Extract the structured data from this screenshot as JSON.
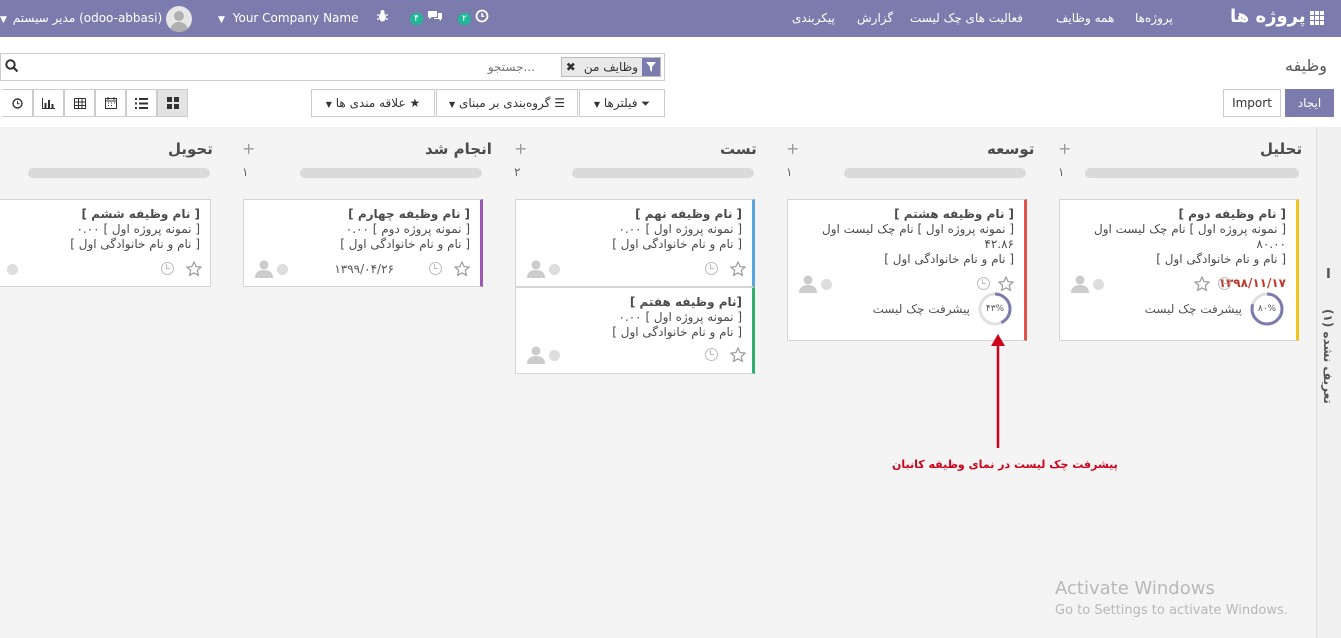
{
  "topbar": {
    "app_title": "پروژه ها",
    "menu": [
      "پروژه‌ها",
      "همه وظایف",
      "فعالیت های چک لیست",
      "گزارش",
      "پیکربندی"
    ],
    "activity_badge": "۲",
    "messages_badge": "۴",
    "company": "Your Company Name",
    "user": "مدیر سیستم (odoo-abbasi)"
  },
  "control": {
    "breadcrumb": "وظیفه",
    "facet_label": "وظایف من",
    "search_placeholder": "جستجو...",
    "create_label": "ایجاد",
    "import_label": "Import",
    "filters_label": "فیلترها",
    "groupby_label": "گروه‌بندی بر مبنای",
    "favorites_label": "علاقه مندی ها"
  },
  "columns": [
    {
      "title": "تحلیل",
      "count": "۱"
    },
    {
      "title": "توسعه",
      "count": "۱"
    },
    {
      "title": "تست",
      "count": "۲"
    },
    {
      "title": "انجام شد",
      "count": "۱"
    },
    {
      "title": "تحویل",
      "count": ""
    }
  ],
  "cards": {
    "c1": {
      "title": "[ نام وظیفه دوم ]",
      "project": "[ نمونه پروژه اول ] نام چک لیست اول",
      "value": "۸۰.۰۰",
      "user": "[ نام و نام خانوادگی اول ]",
      "deadline": "۱۳۹۸/۱۱/۱۷",
      "progress_text": "۸۰%",
      "progress_value": 0.8,
      "progress_label": "پیشرفت چک لیست",
      "accent": "#f0c419"
    },
    "c2": {
      "title": "[ نام وظیفه هشتم ]",
      "project": "[ نمونه پروژه اول ] نام چک لیست اول",
      "value": "۴۲.۸۶",
      "user": "[ نام و نام خانوادگی اول ]",
      "progress_text": "۴۳%",
      "progress_value": 0.43,
      "progress_label": "پیشرفت چک لیست",
      "accent": "#e4544a"
    },
    "c3": {
      "title": "[ نام وظیفه نهم ]",
      "project": "[ نمونه پروژه اول ] ۰.۰۰",
      "user": "[ نام و نام خانوادگی اول ]",
      "accent": "#5aa6e0"
    },
    "c4": {
      "title": "[نام وظیفه هفتم ]",
      "project": "[ نمونه پروژه اول ] ۰.۰۰",
      "user": "[ نام و نام خانوادگی اول ]",
      "accent": "#30b06c"
    },
    "c5": {
      "title": "[ نام وظیفه چهارم ]",
      "project": "[ نمونه پروژه دوم ] ۰.۰۰",
      "user": "[ نام و نام خانوادگی اول ]",
      "deadline": "۱۳۹۹/۰۴/۲۶",
      "accent": "#9b59b6"
    },
    "c6": {
      "title": "[ نام وظیفه ششم ]",
      "project": "[ نمونه پروژه اول ] ۰.۰۰",
      "user": "[ نام و نام خانوادگی اول ]",
      "accent": "#d5d5d5"
    }
  },
  "folded": {
    "label": "تعریف نشده (۱)",
    "count": "I"
  },
  "annotation": "پیشرفت چک لیست در نمای وظیفه کانبان",
  "watermark": {
    "line1": "Activate Windows",
    "line2": "Go to Settings to activate Windows."
  },
  "colors": {
    "brand": "#7c7bad",
    "annotation": "#d0021b"
  }
}
